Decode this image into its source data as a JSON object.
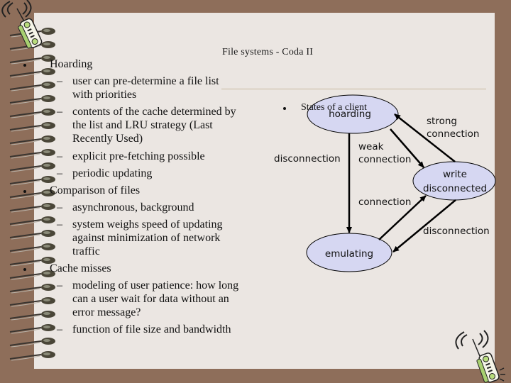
{
  "slide": {
    "title": "File systems - Coda II",
    "colors": {
      "background_frame": "#8e6e5a",
      "page": "#ebe6e2",
      "ellipse_fill": "#d6d7f2",
      "rule": "#c8b89e"
    }
  },
  "bullets": [
    {
      "text": "Hoarding",
      "subitems": [
        {
          "lines": [
            "user can pre-determine a file list",
            "with priorities"
          ]
        },
        {
          "lines": [
            "contents of the cache determined by",
            "the list and LRU strategy (Last",
            "Recently Used)"
          ]
        },
        {
          "lines": [
            "explicit pre-fetching possible"
          ]
        },
        {
          "lines": [
            "periodic updating"
          ]
        }
      ]
    },
    {
      "text": "Comparison of files",
      "subitems": [
        {
          "lines": [
            "asynchronous, background"
          ]
        },
        {
          "lines": [
            "system weighs speed of updating",
            "against minimization of network",
            "traffic"
          ]
        }
      ]
    },
    {
      "text": "Cache misses",
      "subitems": [
        {
          "lines": [
            "modeling of user patience: how long",
            "can a user wait for data without an",
            "error message?"
          ]
        },
        {
          "lines": [
            "function of file size and bandwidth"
          ]
        }
      ]
    }
  ],
  "diagram": {
    "bullet": "States of a client",
    "states": {
      "hoarding": "hoarding",
      "write_disconnected_line1": "write",
      "write_disconnected_line2": "disconnected",
      "emulating": "emulating"
    },
    "transitions": {
      "strong_line1": "strong",
      "strong_line2": "connection",
      "weak_line1": "weak",
      "weak_line2": "connection",
      "disconnection_left": "disconnection",
      "connection": "connection",
      "disconnection_right": "disconnection"
    }
  },
  "decorations": {
    "binding": "spiral-binding",
    "clipart": "cordless-phone-icon"
  }
}
